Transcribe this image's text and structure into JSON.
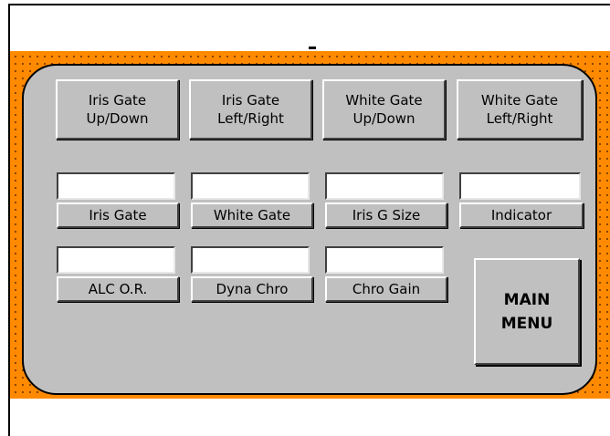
{
  "gate_buttons": [
    {
      "label": "Iris Gate\nUp/Down"
    },
    {
      "label": "Iris Gate\nLeft/Right"
    },
    {
      "label": "White Gate\nUp/Down"
    },
    {
      "label": "White Gate\nLeft/Right"
    }
  ],
  "row1": [
    {
      "label": "Iris Gate",
      "value": ""
    },
    {
      "label": "White Gate",
      "value": ""
    },
    {
      "label": "Iris G Size",
      "value": ""
    },
    {
      "label": "Indicator",
      "value": ""
    }
  ],
  "row2": [
    {
      "label": "ALC O.R.",
      "value": ""
    },
    {
      "label": "Dyna Chro",
      "value": ""
    },
    {
      "label": "Chro Gain",
      "value": ""
    }
  ],
  "main_menu": {
    "label": "MAIN\nMENU"
  },
  "colors": {
    "accent_orange": "#ff8a00",
    "panel_gray": "#c0c0c0",
    "field_white": "#ffffff"
  }
}
